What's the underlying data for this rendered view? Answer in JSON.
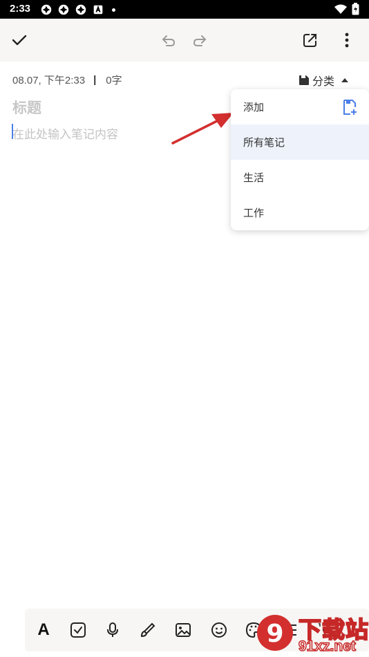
{
  "status_bar": {
    "time": "2:33",
    "notification_icons": [
      "aperture-icon",
      "aperture-icon",
      "aperture-icon",
      "a-badge-icon",
      "dot-icon"
    ],
    "right_icons": [
      "wifi-icon",
      "battery-icon"
    ]
  },
  "toolbar": {
    "icons": [
      "check-icon",
      "undo-icon",
      "redo-icon",
      "share-icon",
      "more-vert-icon"
    ]
  },
  "note_meta": {
    "date": "08.07, 下午2:33",
    "separator": "|",
    "word_count": "0字"
  },
  "category": {
    "label": "分类",
    "icon": "folder-icon",
    "indicator": "caret-up-icon"
  },
  "editor": {
    "title_placeholder": "标题",
    "content_placeholder": "在此处输入笔记内容"
  },
  "category_menu": {
    "items": [
      {
        "label": "添加",
        "icon": "add-folder-icon"
      },
      {
        "label": "所有笔记",
        "selected": true
      },
      {
        "label": "生活"
      },
      {
        "label": "工作"
      }
    ]
  },
  "bottom_toolbar": {
    "text_format_label": "A",
    "icons": [
      "text-format-icon",
      "checkbox-icon",
      "microphone-icon",
      "brush-icon",
      "image-icon",
      "emoji-icon",
      "palette-icon",
      "bullet-list-icon",
      "numbered-list-icon"
    ]
  },
  "watermark": {
    "line1": "下载站",
    "line2": "91xz.net"
  },
  "colors": {
    "accent": "#4a7ee8",
    "arrow": "#d32f2f",
    "toolbar_bg": "#f7f6f4",
    "selected_bg": "#eef3fb"
  }
}
